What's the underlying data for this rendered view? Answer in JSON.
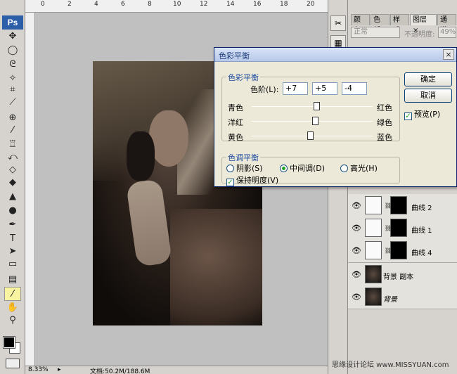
{
  "app": {
    "logo": "Ps"
  },
  "ruler": {
    "top_labels": [
      "0",
      "2",
      "4",
      "6",
      "8",
      "10",
      "12",
      "14",
      "16",
      "18",
      "20"
    ]
  },
  "toolbox": {
    "tools": [
      "move-tool",
      "marquee-tool",
      "lasso-tool",
      "magic-wand-tool",
      "crop-tool",
      "slice-tool",
      "healing-brush-tool",
      "brush-tool",
      "clone-stamp-tool",
      "history-brush-tool",
      "eraser-tool",
      "paint-bucket-tool",
      "blur-tool",
      "dodge-tool",
      "pen-tool",
      "type-tool",
      "path-selection-tool",
      "shape-tool",
      "notes-tool",
      "eyedropper-tool",
      "hand-tool",
      "zoom-tool"
    ],
    "active_tool": "eyedropper-tool",
    "foreground_color": "#000000",
    "background_color": "#ffffff"
  },
  "status": {
    "zoom": "8.33%",
    "doc_size": "文档:50.2M/188.6M"
  },
  "layers_panel": {
    "tabs": [
      "颜色",
      "色板",
      "样式",
      "图层",
      "通道"
    ],
    "active_tab": "图层",
    "tab_close": "×",
    "blend_mode": "正常",
    "opacity_label": "不透明度:",
    "opacity_value": "49%",
    "layers": [
      {
        "name": "曲线 2",
        "type": "adjustment"
      },
      {
        "name": "曲线 1",
        "type": "adjustment"
      },
      {
        "name": "曲线 4",
        "type": "adjustment"
      },
      {
        "name": "背景 副本",
        "type": "image"
      },
      {
        "name": "背景",
        "type": "image"
      }
    ]
  },
  "dialog": {
    "title": "色彩平衡",
    "close": "×",
    "color_balance_legend": "色彩平衡",
    "levels_label": "色阶(L):",
    "levels": [
      "+7",
      "+5",
      "-4"
    ],
    "sliders": [
      {
        "left": "青色",
        "right": "红色",
        "value": 7
      },
      {
        "left": "洋红",
        "right": "绿色",
        "value": 5
      },
      {
        "left": "黄色",
        "right": "蓝色",
        "value": -4
      }
    ],
    "tone_balance_legend": "色调平衡",
    "tones": [
      "阴影(S)",
      "中间调(D)",
      "高光(H)"
    ],
    "selected_tone": "中间调(D)",
    "preserve_luminosity": "保持明度(V)",
    "ok_button": "确定",
    "cancel_button": "取消",
    "preview": "预览(P)"
  },
  "watermark": "思缘设计论坛 www.MISSYUAN.com"
}
